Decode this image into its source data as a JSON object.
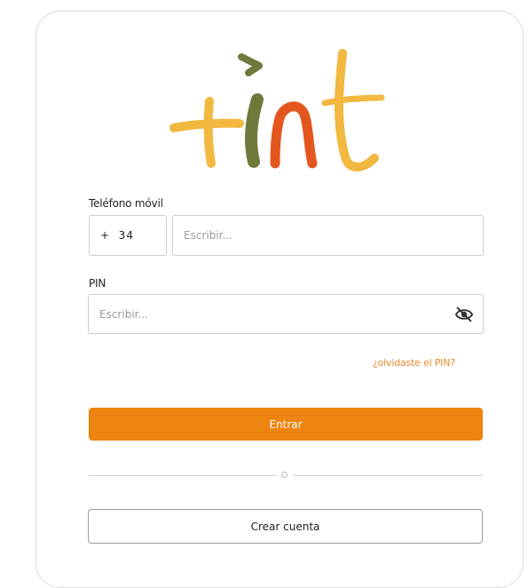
{
  "brand": {
    "logo_text": "+int",
    "colors": {
      "plus": "#f2b840",
      "i": "#6e7a3c",
      "dot": "#6e7a3c",
      "n": "#e3571f",
      "t": "#f2b840"
    }
  },
  "form": {
    "phone": {
      "label": "Teléfono móvil",
      "prefix": "+  34",
      "placeholder": "Escribir..."
    },
    "pin": {
      "label": "PIN",
      "placeholder": "Escribir...",
      "toggle_icon": "eye-slash-icon"
    },
    "forgot_link": "¿olvidaste el PIN?",
    "submit_label": "Entrar",
    "create_account_label": "Crear cuenta"
  },
  "colors": {
    "accent": "#ee8510",
    "link": "#e88a2a",
    "border": "#cfcfcf"
  }
}
